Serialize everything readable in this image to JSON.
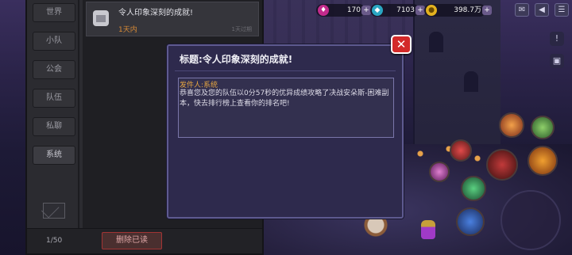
{
  "hud": {
    "gem_value": "170",
    "diamond_value": "7103",
    "gold_value": "398.7万"
  },
  "mail": {
    "tabs": [
      "世界",
      "小队",
      "公会",
      "队伍",
      "私聊",
      "系统"
    ],
    "active_tab_index": 5,
    "item": {
      "title": "令人印象深刻的成就!",
      "time": "1天内",
      "expiry": "1天过期"
    },
    "page_count": "1/50",
    "delete_read_label": "删除已读"
  },
  "dialog": {
    "title": "标题:令人印象深刻的成就!",
    "sender_label": "发件人:",
    "sender_name": "系统",
    "body": "恭喜您及您的队伍以0分57秒的优异成绩攻略了决战安朵斯-困难副本，快去排行榜上查看你的排名吧!",
    "close_icon": "✕"
  },
  "colors": {
    "accent_orange": "#e6a640",
    "close_red": "#d32a2a",
    "dialog_bg": "#2e2a4d"
  }
}
